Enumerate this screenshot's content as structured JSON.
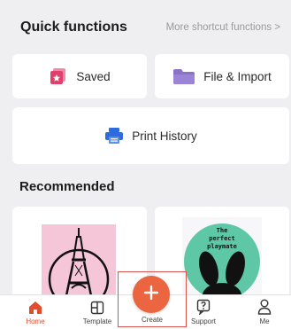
{
  "quick_functions": {
    "title": "Quick functions",
    "more_link": "More shortcut functions >",
    "items": [
      {
        "label": "Saved",
        "icon": "saved-icon"
      },
      {
        "label": "File & Import",
        "icon": "folder-icon"
      },
      {
        "label": "Print History",
        "icon": "printer-icon"
      }
    ]
  },
  "recommended": {
    "title": "Recommended",
    "items": [
      {
        "name": "eiffel-tower-template",
        "icon": "eiffel-tower-icon"
      },
      {
        "name": "perfect-playmate-template",
        "text": "The perfect playmate",
        "icon": "bunny-icon"
      }
    ]
  },
  "tabbar": {
    "items": [
      {
        "label": "Home",
        "icon": "home-icon",
        "active": true
      },
      {
        "label": "Template",
        "icon": "template-icon",
        "active": false
      },
      {
        "label": "Create",
        "icon": "plus-icon",
        "active": false
      },
      {
        "label": "Support",
        "icon": "support-icon",
        "active": false
      },
      {
        "label": "Me",
        "icon": "person-icon",
        "active": false
      }
    ]
  },
  "colors": {
    "accent": "#ea6540",
    "active_tab": "#e04e2e",
    "background": "#efeff1",
    "folder": "#8b72c6",
    "printer": "#2d6cdf",
    "saved": "#e8537a"
  }
}
